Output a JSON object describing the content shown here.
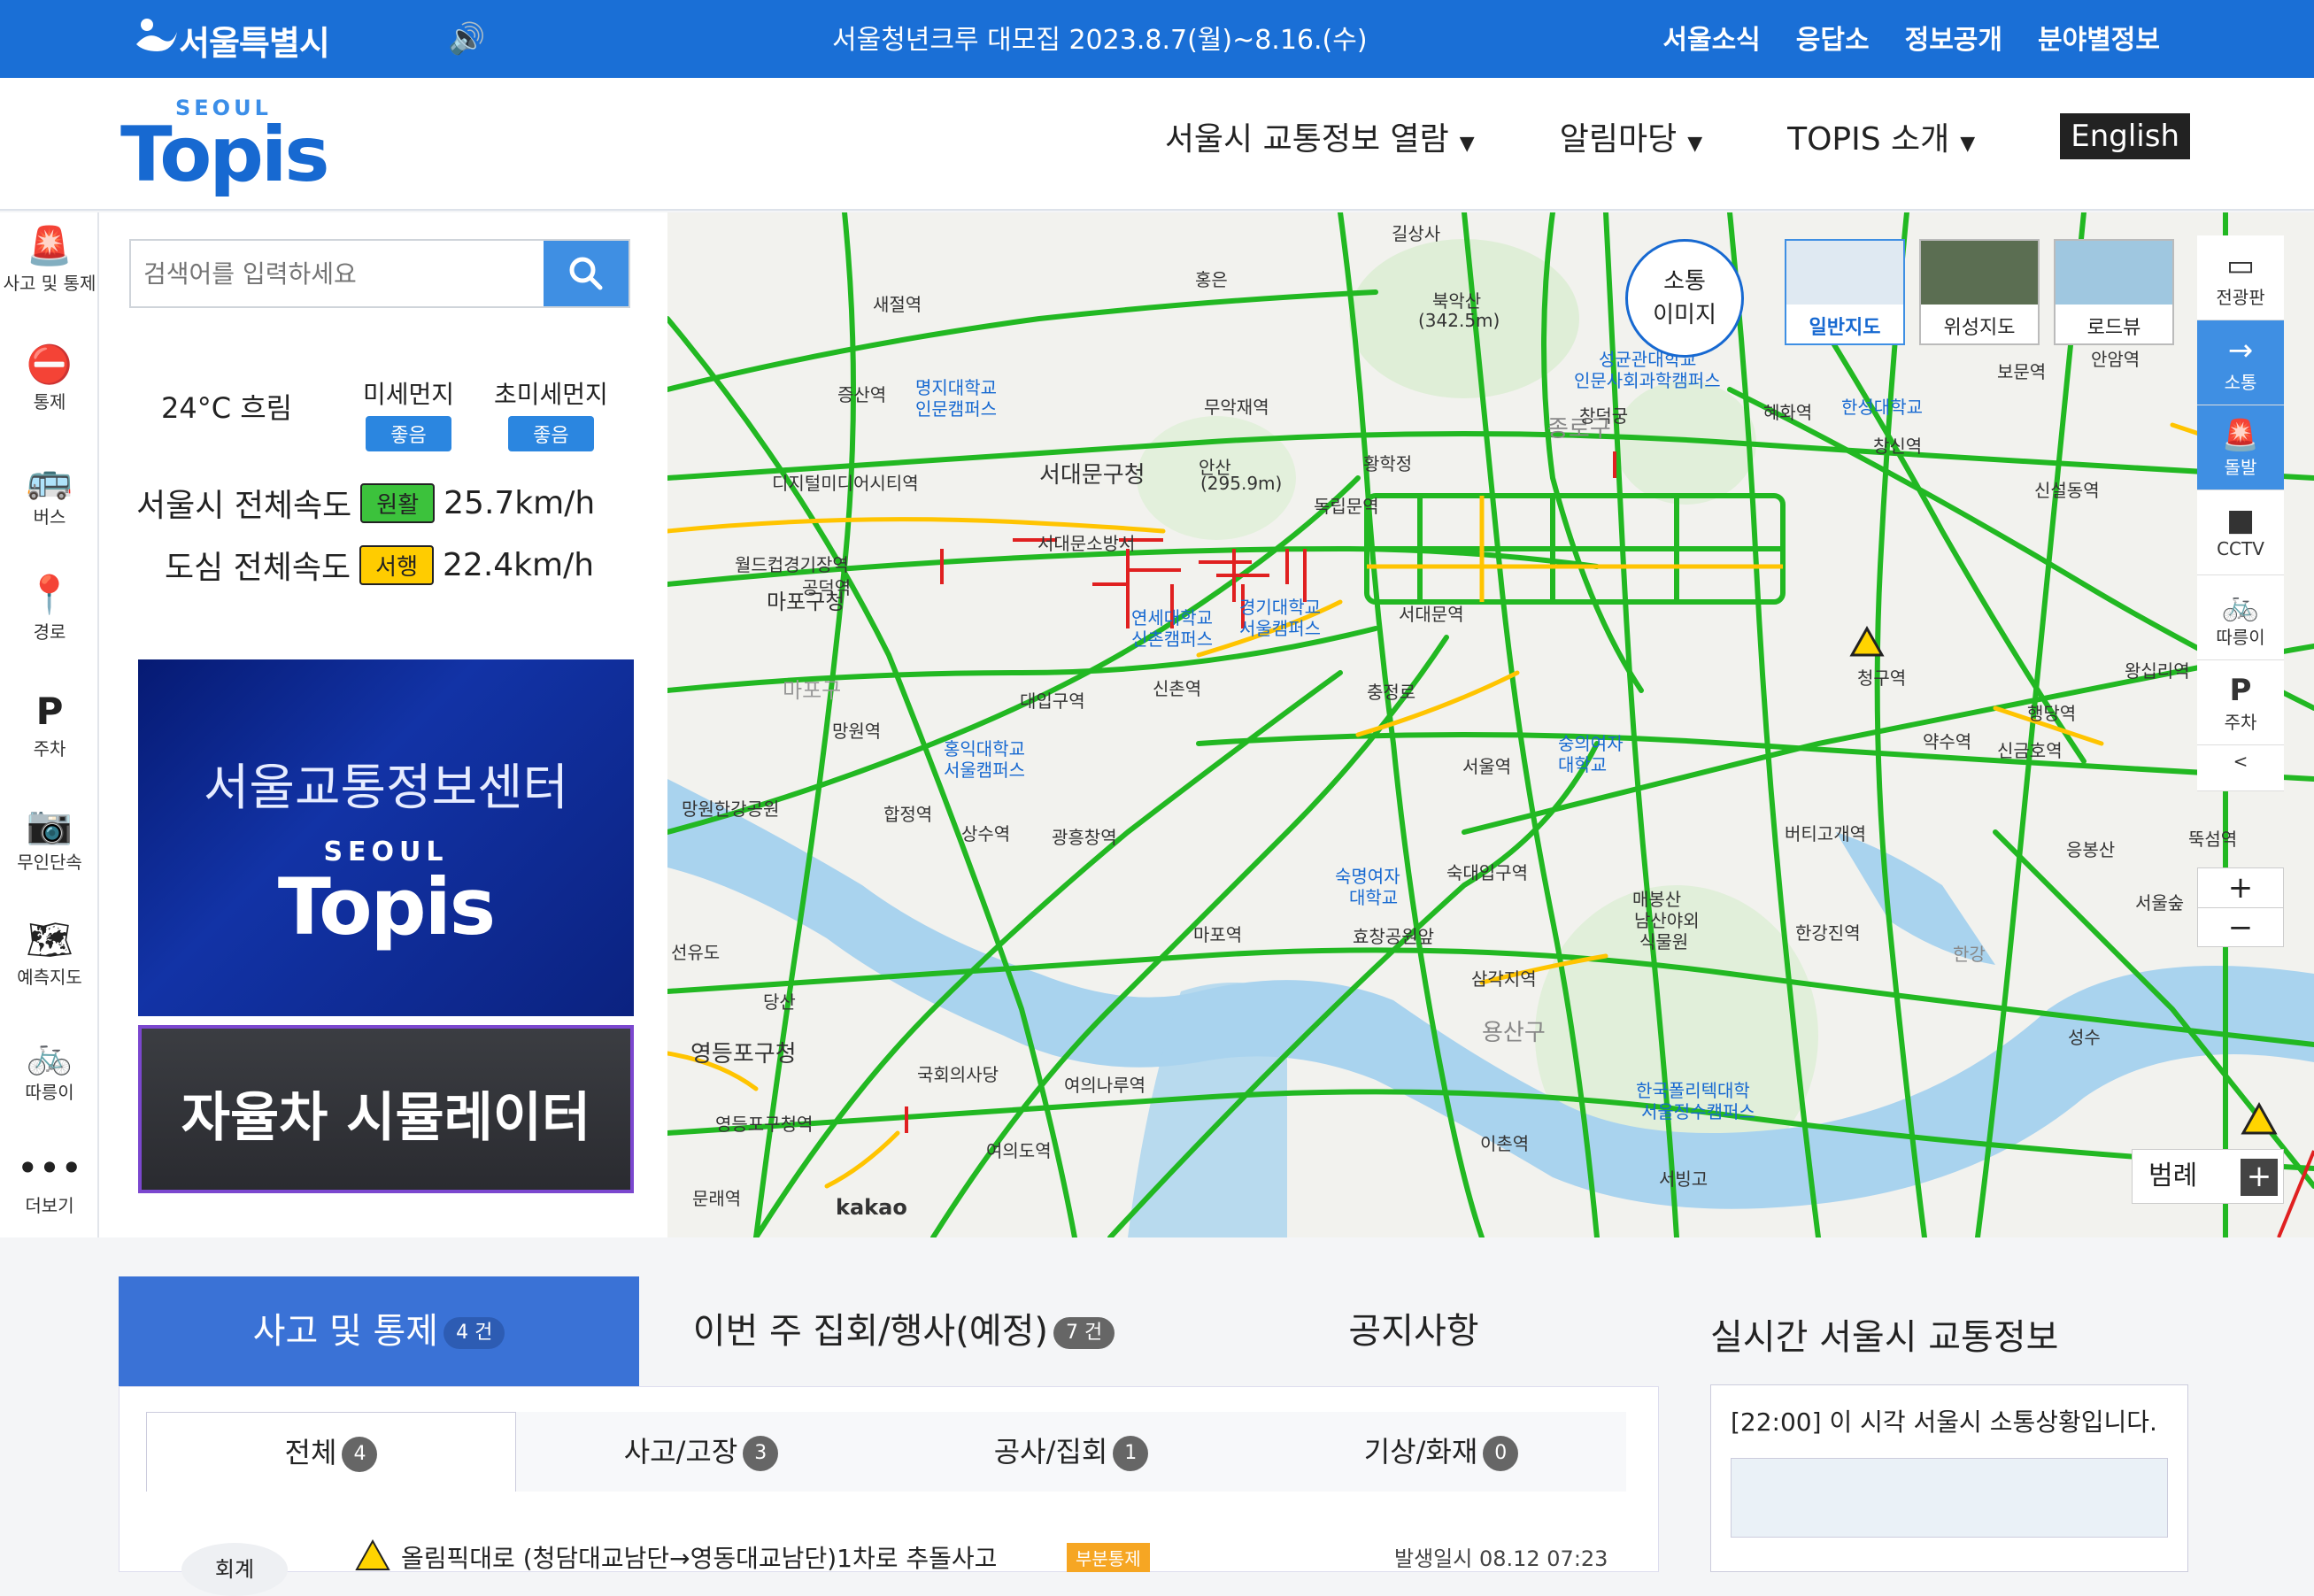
{
  "topbar": {
    "city_name": "서울특별시",
    "notice": "서울청년크루 대모집 2023.8.7(월)~8.16.(수)",
    "links": [
      "서울소식",
      "응답소",
      "정보공개",
      "분야별정보"
    ]
  },
  "header": {
    "brand_small": "SEOUL",
    "brand_large": "Topis",
    "nav": [
      "서울시 교통정보 열람",
      "알림마당",
      "TOPIS 소개"
    ],
    "english": "English"
  },
  "rail": {
    "items": [
      {
        "label": "사고 및 통제",
        "icon": "alert-beacon-icon"
      },
      {
        "label": "통제",
        "icon": "no-entry-icon"
      },
      {
        "label": "버스",
        "icon": "bus-icon"
      },
      {
        "label": "경로",
        "icon": "route-icon"
      },
      {
        "label": "주차",
        "icon": "parking-icon"
      },
      {
        "label": "무인단속",
        "icon": "camera-icon"
      },
      {
        "label": "예측지도",
        "icon": "map-icon"
      },
      {
        "label": "따릉이",
        "icon": "bicycle-icon"
      },
      {
        "label": "더보기",
        "icon": "more-icon"
      }
    ]
  },
  "search": {
    "placeholder": "검색어를 입력하세요"
  },
  "weather": {
    "text": "24°C 흐림",
    "fine_dust_label": "미세먼지",
    "fine_dust_status": "좋음",
    "ultra_dust_label": "초미세먼지",
    "ultra_dust_status": "좋음"
  },
  "speeds": {
    "city_label": "서울시 전체속도",
    "city_status": "원활",
    "city_value": "25.7km/h",
    "downtown_label": "도심 전체속도",
    "downtown_status": "서행",
    "downtown_value": "22.4km/h"
  },
  "promos": {
    "center_title": "서울교통정보센터",
    "center_brand_small": "SEOUL",
    "center_brand_large": "Topis",
    "simulator": "자율차 시뮬레이터"
  },
  "map": {
    "sotong_line1": "소통",
    "sotong_line2": "이미지",
    "types": [
      "일반지도",
      "위성지도",
      "로드뷰"
    ],
    "right_tools": [
      {
        "label": "전광판",
        "icon": "billboard-icon"
      },
      {
        "label": "소통",
        "icon": "arrow-right-icon"
      },
      {
        "label": "돌발",
        "icon": "alert-beacon-icon"
      },
      {
        "label": "CCTV",
        "icon": "video-camera-icon"
      },
      {
        "label": "따릉이",
        "icon": "bicycle-icon"
      },
      {
        "label": "주차",
        "icon": "parking-icon"
      }
    ],
    "collapse": "<",
    "zoom_in": "+",
    "zoom_out": "−",
    "legend": "범례",
    "legend_plus": "+",
    "attribution": "kakao",
    "labels": [
      "길상사",
      "북악산",
      "(342.5m)",
      "홍은",
      "새절역",
      "증산역",
      "명지대학교",
      "인문캠퍼스",
      "무악재역",
      "안산",
      "(295.9m)",
      "서대문구청",
      "서대문소방서",
      "디지털미디어시티역",
      "월드컵경기장역",
      "마포구청",
      "망원역",
      "마포구",
      "연세대학교",
      "신촌캠퍼스",
      "경기대학교",
      "서울캠퍼스",
      "신촌역",
      "대입구역",
      "홍익대학교",
      "서울캠퍼스",
      "합정역",
      "상수역",
      "광흥창역",
      "망원한강공원",
      "충정로",
      "서대문역",
      "서울역",
      "숙명여자",
      "대학교",
      "숙대입구역",
      "효창공원앞",
      "마포역",
      "삼각지역",
      "용산구",
      "영등포구청",
      "국회의사당",
      "여의나루역",
      "여의도역",
      "당산",
      "선유도",
      "영등포구청역",
      "문래역",
      "이촌역",
      "서빙고",
      "남산야외",
      "식물원",
      "매봉산",
      "버티고개역",
      "성균관대학교",
      "인문사회과학캠퍼스",
      "혜화역",
      "한성대학교",
      "창신역",
      "종로구",
      "창덕궁",
      "독립문역",
      "보문역",
      "안암역",
      "신설동역",
      "청구역",
      "약수역",
      "신금호역",
      "행당역",
      "왕십리역",
      "한강",
      "응봉산",
      "서울숲",
      "성수",
      "뚝섬역",
      "한국폴리텍대학",
      "서울정수캠퍼스",
      "숭의여자",
      "대학교",
      "황학정",
      "공덕역",
      "한강진역"
    ]
  },
  "bottom": {
    "tabs": [
      {
        "label": "사고 및 통제",
        "count": "4 건"
      },
      {
        "label": "이번 주 집회/행사(예정)",
        "count": "7 건"
      },
      {
        "label": "공지사항",
        "count": ""
      }
    ],
    "subtabs": [
      {
        "label": "전체",
        "count": "4"
      },
      {
        "label": "사고/고장",
        "count": "3"
      },
      {
        "label": "공사/집회",
        "count": "1"
      },
      {
        "label": "기상/화재",
        "count": "0"
      }
    ],
    "incident": {
      "side_label": "회계",
      "text": "올림픽대로 (청담대교남단→영동대교남단)1차로 추돌사고",
      "badge": "부분통제",
      "time": "발생일시 08.12 07:23"
    },
    "realtime": {
      "title": "실시간 서울시 교통정보",
      "text": "[22:00] 이 시각 서울시 소통상황입니다."
    }
  },
  "colors": {
    "primary": "#1a6fd6",
    "road_smooth": "#22b822",
    "road_slow": "#ffc400",
    "road_jam": "#e02020",
    "river": "#a9d3ee"
  }
}
